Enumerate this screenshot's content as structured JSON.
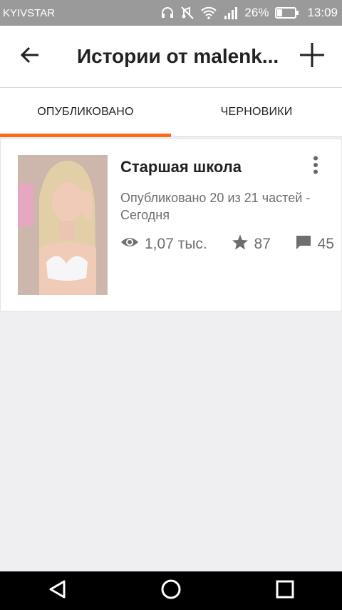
{
  "status_bar": {
    "carrier": "KYIVSTAR",
    "battery": "26%",
    "time": "13:09"
  },
  "app_bar": {
    "title": "Истории от malenk..."
  },
  "tabs": [
    {
      "label": "ОПУБЛИКОВАНО",
      "active": true
    },
    {
      "label": "ЧЕРНОВИКИ",
      "active": false
    }
  ],
  "story": {
    "title": "Старшая школа",
    "status": "Опубликовано 20 из 21 частей - Сегодня",
    "views": "1,07 тыс.",
    "votes": "87",
    "comments": "45"
  },
  "colors": {
    "accent": "#ff6a1a",
    "status_bar_bg": "#9a9a9a",
    "page_bg": "#efeef0"
  }
}
